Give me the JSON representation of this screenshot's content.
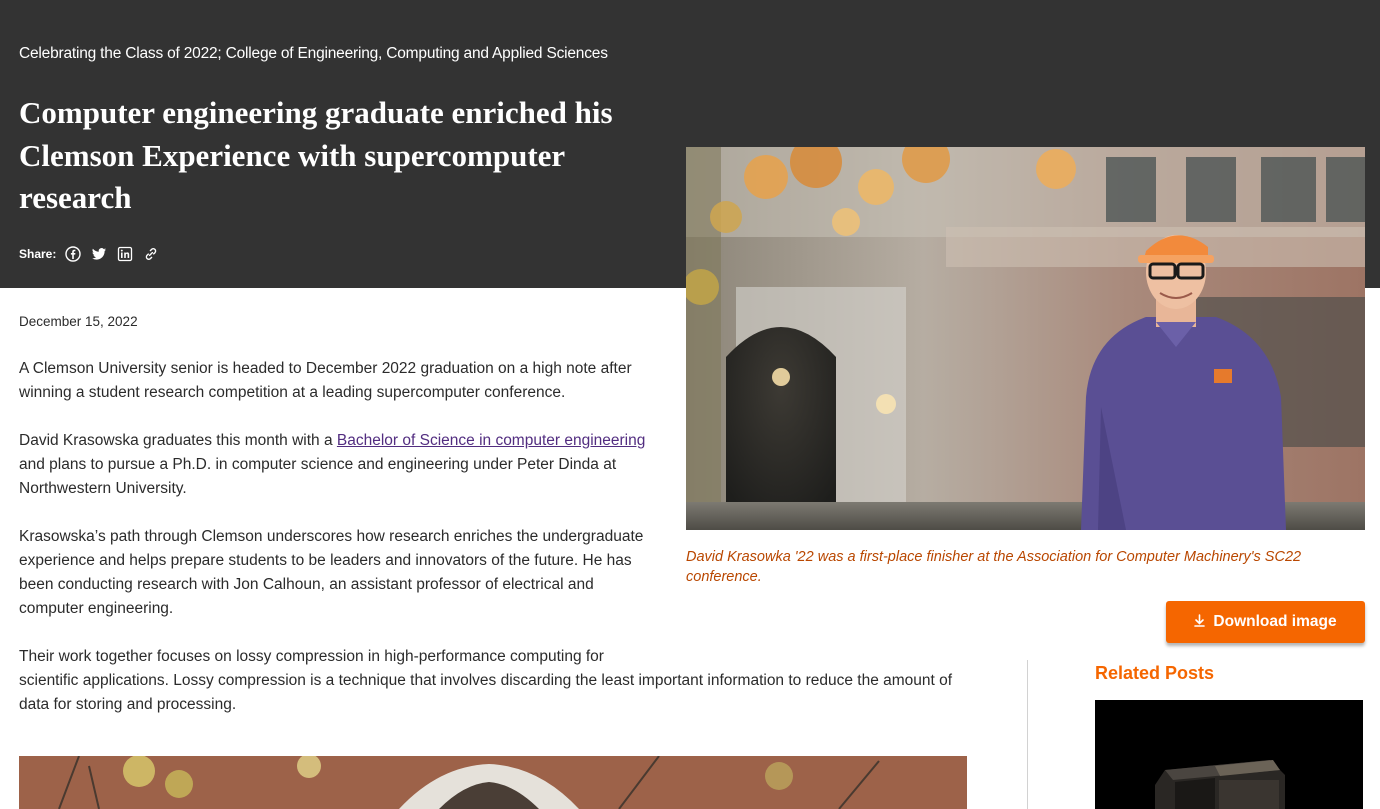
{
  "header": {
    "eyebrow": "Celebrating the Class of 2022; College of Engineering, Computing and Applied Sciences",
    "title": "Computer engineering graduate enriched his Clemson Experience with supercomputer research",
    "share_label": "Share:",
    "share_icons": [
      "facebook-icon",
      "twitter-icon",
      "linkedin-icon",
      "link-icon"
    ]
  },
  "article": {
    "date": "December 15, 2022",
    "p1": "A Clemson University senior is headed to December 2022 graduation on a high note after winning a student research competition at a leading supercomputer conference.",
    "p2_before": "David Krasowska graduates this month with a ",
    "p2_link": "Bachelor of Science in computer engineering",
    "p2_after": " and plans to pursue a Ph.D. in computer science and engineering under Peter Dinda at Northwestern University.",
    "p3": "Krasowska’s path through Clemson underscores how research enriches the undergraduate experience and helps prepare students to be leaders and innovators of the future. He has been conducting research with Jon Calhoun, an assistant professor of electrical and computer engineering.",
    "p4_line1": "Their work together focuses on lossy compression in high-performance computing for",
    "p4_rest": "scientific applications. Lossy compression is a technique that involves discarding the least important information to reduce the amount of data for storing and processing."
  },
  "featured_image": {
    "caption": "David Krasowka '22 was a first-place finisher at the Association for Computer Machinery's SC22 conference.",
    "download_label": "Download image",
    "download_icon": "download-arrow-icon"
  },
  "sidebar": {
    "related_title": "Related Posts"
  },
  "colors": {
    "hero_bg": "#333333",
    "accent_orange": "#f56600",
    "caption_orange": "#b94700",
    "link_purple": "#522d80"
  }
}
